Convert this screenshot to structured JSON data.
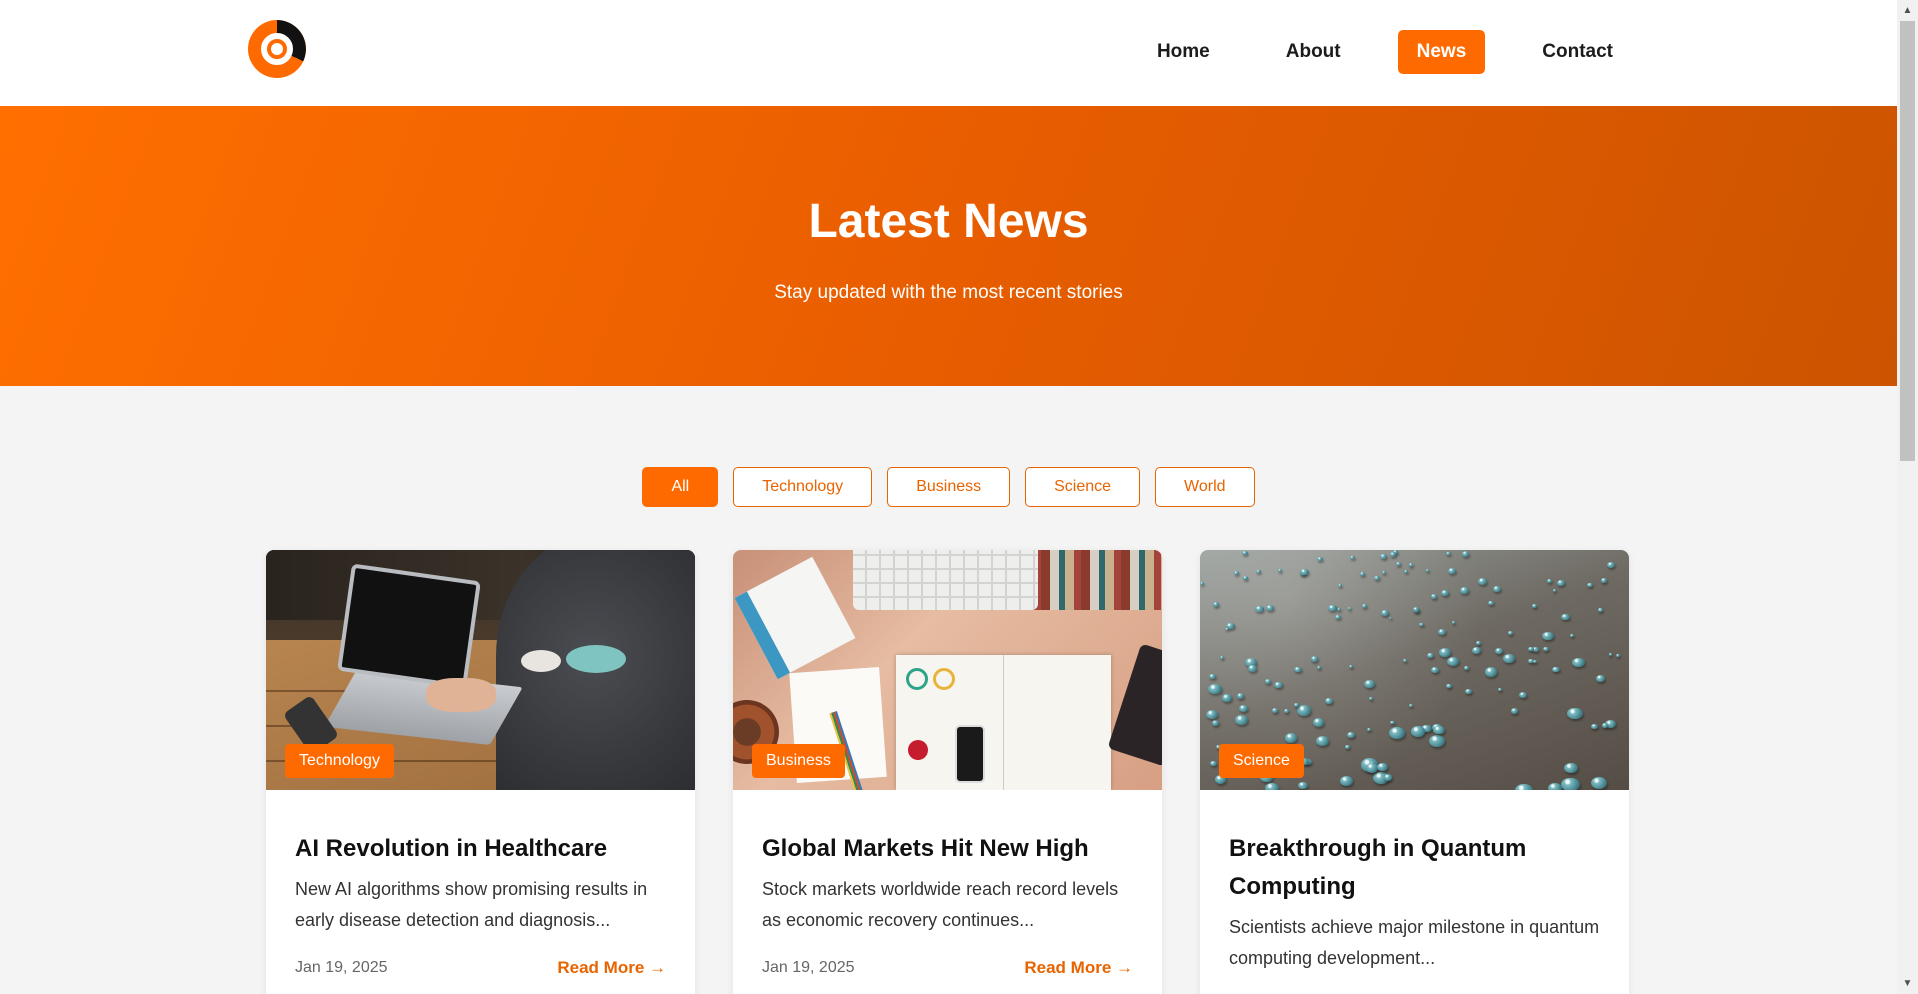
{
  "nav": {
    "items": [
      {
        "label": "Home",
        "active": false
      },
      {
        "label": "About",
        "active": false
      },
      {
        "label": "News",
        "active": true
      },
      {
        "label": "Contact",
        "active": false
      }
    ]
  },
  "hero": {
    "title": "Latest News",
    "subtitle": "Stay updated with the most recent stories"
  },
  "filters": [
    {
      "label": "All",
      "active": true
    },
    {
      "label": "Technology",
      "active": false
    },
    {
      "label": "Business",
      "active": false
    },
    {
      "label": "Science",
      "active": false
    },
    {
      "label": "World",
      "active": false
    }
  ],
  "cards": [
    {
      "tag": "Technology",
      "title": "AI Revolution in Healthcare",
      "excerpt": "New AI algorithms show promising results in early disease detection and diagnosis...",
      "date": "Jan 19, 2025",
      "read_more": "Read More →"
    },
    {
      "tag": "Business",
      "title": "Global Markets Hit New High",
      "excerpt": "Stock markets worldwide reach record levels as economic recovery continues...",
      "date": "Jan 19, 2025",
      "read_more": "Read More →"
    },
    {
      "tag": "Science",
      "title": "Breakthrough in Quantum Computing",
      "excerpt": "Scientists achieve major milestone in quantum computing development...",
      "date": "",
      "read_more": ""
    }
  ],
  "colors": {
    "accent": "#ff6a00",
    "accent_dark": "#cc5400",
    "page_bg": "#f4f4f4"
  },
  "icons": {
    "logo": "site-logo",
    "scroll_up": "scroll-up-arrow",
    "scroll_down": "scroll-down-arrow"
  }
}
